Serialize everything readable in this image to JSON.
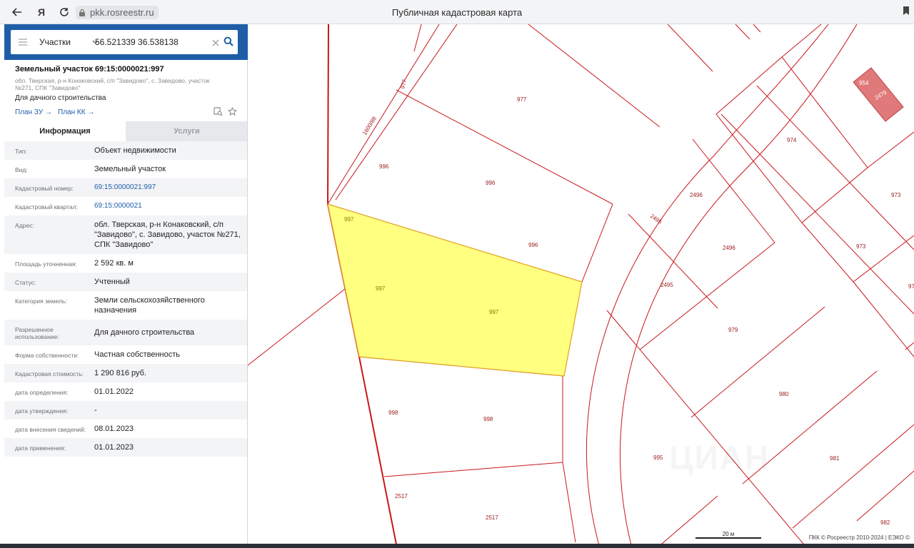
{
  "browser": {
    "url": "pkk.rosreestr.ru",
    "title": "Публичная кадастровая карта",
    "yandex_glyph": "Я"
  },
  "search": {
    "layer_label": "Участки",
    "query": "56.521339 36.538138"
  },
  "object": {
    "title": "Земельный участок 69:15:0000021:997",
    "address": "обл. Тверская, р-н Конаковский, с/п \"Завидово\", с. Завидово, участок №271, СПК \"Завидово\"",
    "use": "Для дачного строительства",
    "plan_zu": "План ЗУ →",
    "plan_kk": "План КК →"
  },
  "tabs": {
    "info": "Информация",
    "services": "Услуги"
  },
  "props": [
    {
      "label": "Тип:",
      "value": "Объект недвижимости"
    },
    {
      "label": "Вид:",
      "value": "Земельный участок"
    },
    {
      "label": "Кадастровый номер:",
      "value": "69:15:0000021:997"
    },
    {
      "label": "Кадастровый квартал:",
      "value": "69:15:0000021"
    },
    {
      "label": "Адрес:",
      "value": "обл. Тверская, р-н Конаковский, с/п \"Завидово\", с. Завидово, участок №271, СПК \"Завидово\""
    },
    {
      "label": "Площадь уточненная:",
      "value": "2 592 кв. м"
    },
    {
      "label": "Статус:",
      "value": "Учтенный"
    },
    {
      "label": "Категория земель:",
      "value": "Земли сельскохозяйственного назначения"
    },
    {
      "label": "Разрешенное использование:",
      "value": "Для дачного строительства"
    },
    {
      "label": "Форма собственности:",
      "value": "Частная собственность"
    },
    {
      "label": "Кадастровая стоимость:",
      "value": "1 290 816 руб."
    },
    {
      "label": "дата определения:",
      "value": "01.01.2022"
    },
    {
      "label": "дата утверждения:",
      "value": "-"
    },
    {
      "label": "дата внесения сведений:",
      "value": "08.01.2023"
    },
    {
      "label": "дата применения:",
      "value": "01.01.2023"
    }
  ],
  "map": {
    "labels": {
      "l977a": "977",
      "l977b": "977",
      "l1600": "1600/88",
      "l996a": "996",
      "l996b": "996",
      "l996c": "996",
      "l997a": "997",
      "l997b": "997",
      "l997c": "997",
      "l998a": "998",
      "l998b": "998",
      "l2517a": "2517",
      "l2517b": "2517",
      "l995": "995",
      "l2496a": "2496",
      "l2496b": "2496",
      "l2495a": "2495",
      "l2495b": "2495",
      "l979": "979",
      "l980": "980",
      "l981": "981",
      "l982": "982",
      "l974": "974",
      "l973a": "973",
      "l973b": "973",
      "l97x": "97",
      "l954": "954",
      "l2479": "2479"
    },
    "watermark": "ЦИАН",
    "scale": "20 м",
    "copyright": "ПКК © Росреестр 2010-2024 | ЕЭКО ©"
  },
  "colors": {
    "accent": "#1e5ea8",
    "selected_fill": "#ffff80",
    "parcel_border": "#c8171b",
    "highlight_parcel": "#e07a7a"
  }
}
